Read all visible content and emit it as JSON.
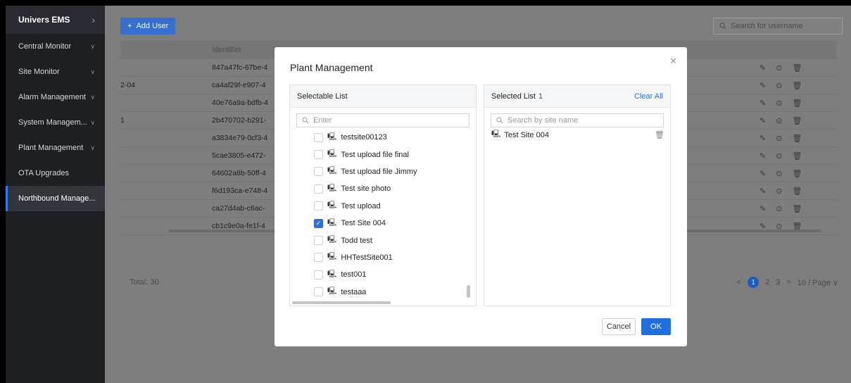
{
  "sidebar": {
    "brand": "Univers EMS",
    "items": [
      {
        "label": "Central Monitor",
        "chevron": true
      },
      {
        "label": "Site Monitor",
        "chevron": true
      },
      {
        "label": "Alarm Management",
        "chevron": true
      },
      {
        "label": "System Managem...",
        "chevron": true
      },
      {
        "label": "Plant Management",
        "chevron": true
      },
      {
        "label": "OTA Upgrades",
        "chevron": false
      },
      {
        "label": "Northbound Manage...",
        "chevron": false,
        "active": true
      }
    ]
  },
  "toolbar": {
    "add_user_label": "Add User",
    "search_placeholder": "Search for username"
  },
  "table": {
    "header_identifier": "Identifier",
    "rows": [
      {
        "left": "",
        "identifier": "847a47fc-67be-4"
      },
      {
        "left": "2-04",
        "identifier": "ca4af29f-e907-4"
      },
      {
        "left": "",
        "identifier": "40e76a9a-bdfb-4"
      },
      {
        "left": "1",
        "identifier": "2b470702-b291-"
      },
      {
        "left": "",
        "identifier": "a3834e79-0cf3-4"
      },
      {
        "left": "",
        "identifier": "5cae3805-e472-"
      },
      {
        "left": "",
        "identifier": "64602a8b-50ff-4"
      },
      {
        "left": "",
        "identifier": "f6d193ca-e748-4"
      },
      {
        "left": "",
        "identifier": "ca27d4ab-c6ac-"
      },
      {
        "left": "",
        "identifier": "cb1c9e0a-fe1f-4"
      }
    ],
    "total": "Total: 30"
  },
  "pagination": {
    "current": "1",
    "pages": [
      "2",
      "3"
    ],
    "page_size": "10 / Page"
  },
  "modal": {
    "title": "Plant Management",
    "left_panel": {
      "title": "Selectable List",
      "search_placeholder": "Enter",
      "items": [
        {
          "label": "testsite00123",
          "checked": false
        },
        {
          "label": "Test upload file final",
          "checked": false
        },
        {
          "label": "Test upload file Jimmy",
          "checked": false
        },
        {
          "label": "Test site photo",
          "checked": false
        },
        {
          "label": "Test upload",
          "checked": false
        },
        {
          "label": "Test Site 004",
          "checked": true
        },
        {
          "label": "Todd test",
          "checked": false
        },
        {
          "label": "HHTestSite001",
          "checked": false
        },
        {
          "label": "test001",
          "checked": false
        },
        {
          "label": "testaaa",
          "checked": false
        }
      ]
    },
    "right_panel": {
      "title": "Selected List",
      "count": "1",
      "clear_label": "Clear All",
      "search_placeholder": "Search by site name",
      "items": [
        {
          "label": "Test Site 004"
        }
      ]
    },
    "cancel_label": "Cancel",
    "ok_label": "OK"
  },
  "colors": {
    "accent": "#2f6fd8",
    "sidebar_bg": "#1e1f23",
    "overlay": "#7e7e7e"
  }
}
